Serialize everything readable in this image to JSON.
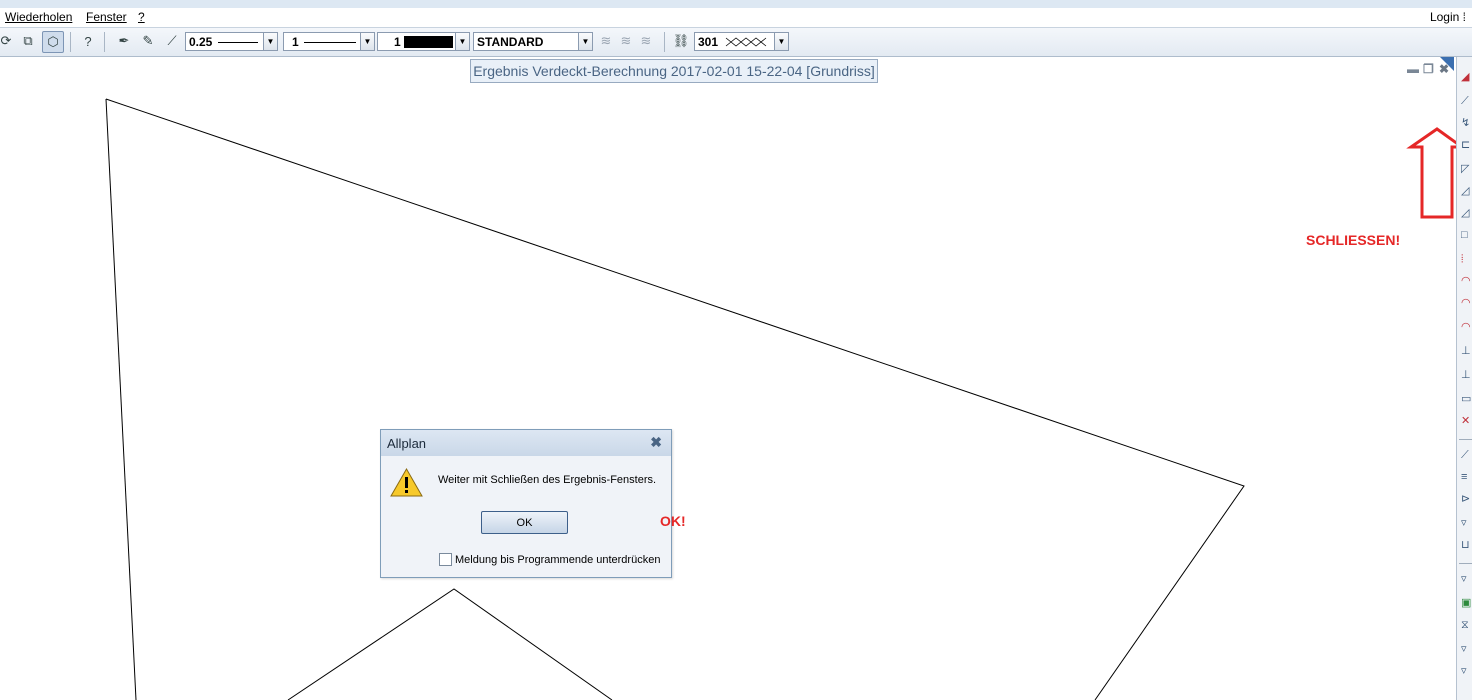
{
  "menubar": {
    "items": [
      "Wiederholen",
      "Fenster",
      "?"
    ],
    "login": "Login"
  },
  "toolbar": {
    "pen_thickness": "0.25",
    "line_type": "1",
    "color_number": "1",
    "layer": "STANDARD",
    "pattern_number": "301"
  },
  "window": {
    "title": "Ergebnis  Verdeckt-Berechnung  2017-02-01  15-22-04  [Grundriss]"
  },
  "dialog": {
    "title": "Allplan",
    "close_glyph": "✖",
    "message": "Weiter mit Schließen des Ergebnis-Fensters.",
    "ok_label": "OK",
    "checkbox_label": "Meldung bis Programmende unterdrücken"
  },
  "annotations": {
    "close_hint": "SCHLIESSEN!",
    "ok_hint": "OK!",
    "color": "#e52727"
  },
  "icons": [
    "sync-icon",
    "copy-icon",
    "view-3d-icon",
    "help-icon",
    "pen-icon",
    "pencil-icon",
    "pipette-icon",
    "layer-icon",
    "chain-icon",
    "minimize-icon",
    "restore-icon",
    "close-icon",
    "warning-icon"
  ]
}
